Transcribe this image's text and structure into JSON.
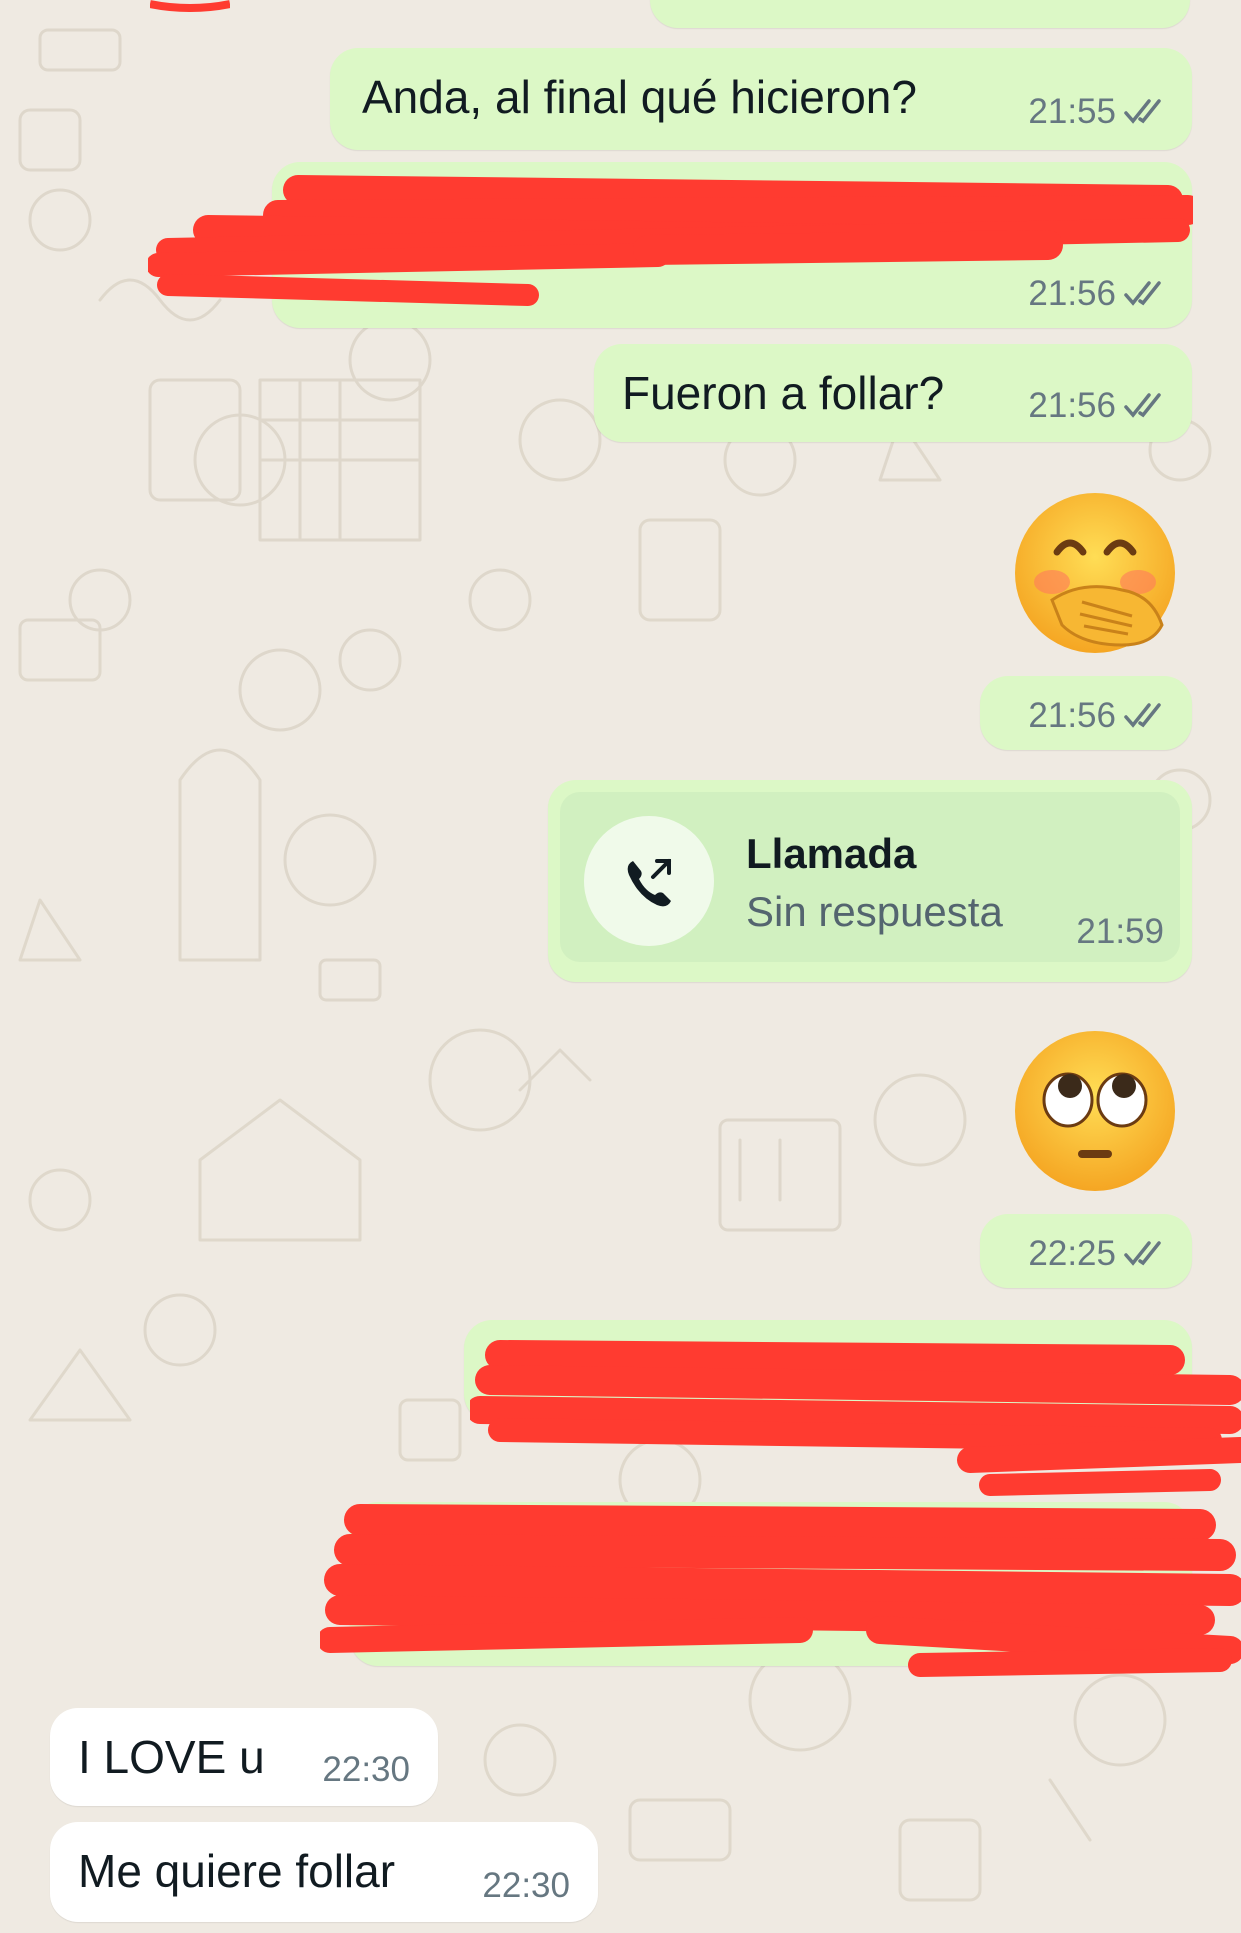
{
  "chat": {
    "messages": [
      {
        "id": "m1",
        "direction": "outgoing",
        "text": "Anda, al final qué hicieron?",
        "time": "21:55",
        "status": "read"
      },
      {
        "id": "m2",
        "direction": "outgoing",
        "text": "",
        "redacted": true,
        "time": "21:56",
        "status": "read"
      },
      {
        "id": "m3",
        "direction": "outgoing",
        "text": "Fueron a follar?",
        "time": "21:56",
        "status": "read"
      },
      {
        "id": "m4",
        "direction": "outgoing",
        "emoji": "hand-over-mouth-emoji",
        "time": "21:56",
        "status": "read"
      },
      {
        "id": "m5",
        "direction": "outgoing",
        "type": "call",
        "call_title": "Llamada",
        "call_subtitle": "Sin respuesta",
        "time": "21:59",
        "icon": "phone-outgoing-icon"
      },
      {
        "id": "m6",
        "direction": "outgoing",
        "emoji": "eye-roll-emoji",
        "time": "22:25",
        "status": "read"
      },
      {
        "id": "m7",
        "direction": "outgoing",
        "text": "",
        "redacted": true
      },
      {
        "id": "m8",
        "direction": "outgoing",
        "text": "",
        "redacted": true
      },
      {
        "id": "m9",
        "direction": "incoming",
        "text": "I LOVE u",
        "time": "22:30"
      },
      {
        "id": "m10",
        "direction": "incoming",
        "text": "Me quiere follar",
        "time": "22:30"
      }
    ]
  },
  "colors": {
    "outgoing_bubble": "#dcf8c6",
    "incoming_bubble": "#ffffff",
    "wallpaper": "#efeae2",
    "redaction": "#ff3b30",
    "read_ticks": "#667781"
  }
}
